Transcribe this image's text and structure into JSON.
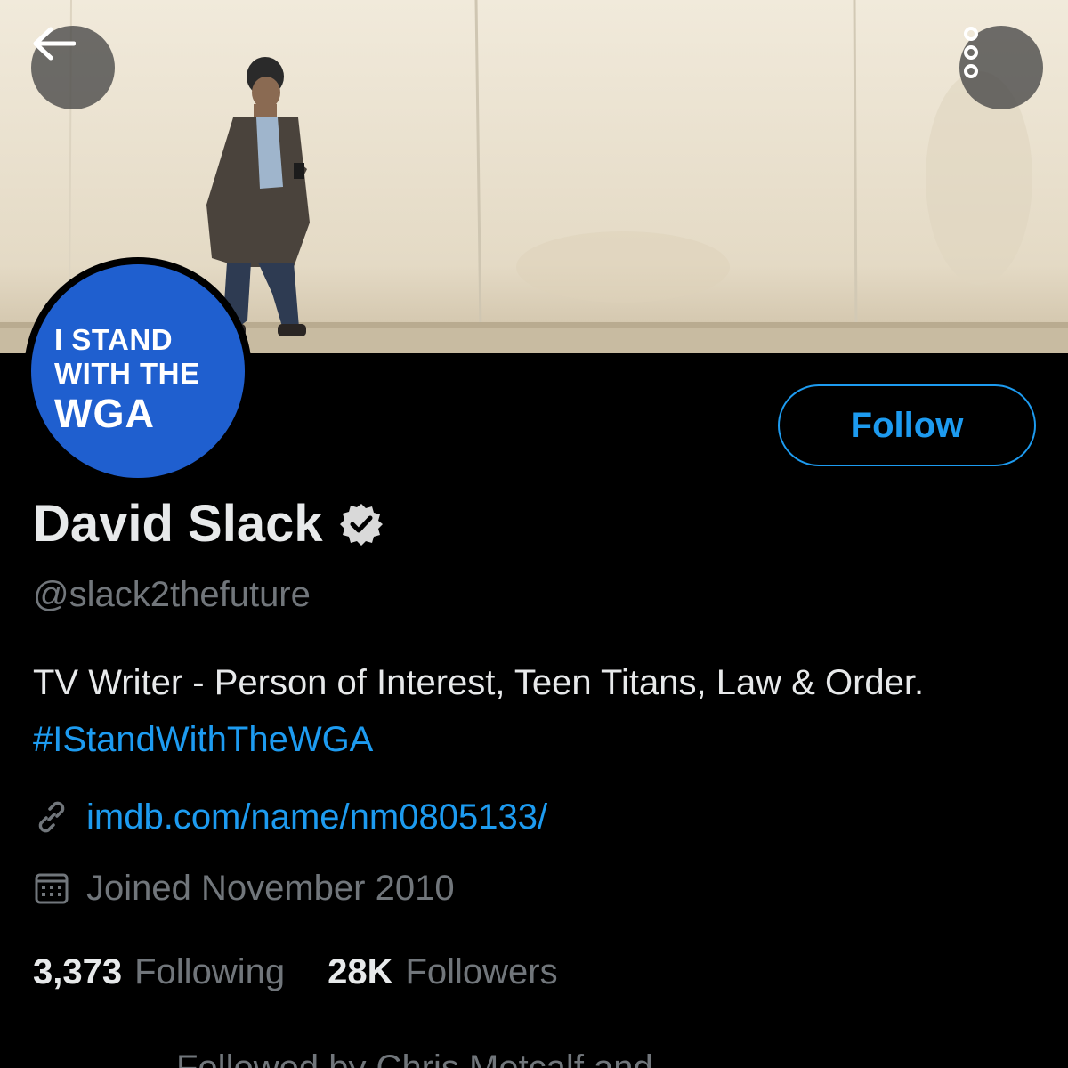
{
  "header": {
    "back_icon": "arrow-left-icon",
    "more_icon": "more-vertical-icon",
    "banner_colors": {
      "wall": "#ebe3d2",
      "ground": "#cbbfa6"
    }
  },
  "avatar": {
    "line1": "I STAND",
    "line2": "WITH THE",
    "line3": "WGA",
    "background": "#1f5fcf"
  },
  "follow_button": {
    "label": "Follow",
    "color": "#1d9bf0"
  },
  "profile": {
    "display_name": "David Slack",
    "verified_icon": "verified-badge-icon",
    "handle": "@slack2thefuture",
    "bio_text": "TV Writer - Person of Interest, Teen Titans, Law & Order.",
    "bio_hashtag": "#IStandWithTheWGA",
    "link_icon": "link-icon",
    "link": "imdb.com/name/nm0805133/",
    "calendar_icon": "calendar-icon",
    "joined": "Joined November 2010"
  },
  "stats": {
    "following_count": "3,373",
    "following_label": "Following",
    "followers_count": "28K",
    "followers_label": "Followers"
  },
  "followed_by": "Followed by Chris Metcalf and ..."
}
